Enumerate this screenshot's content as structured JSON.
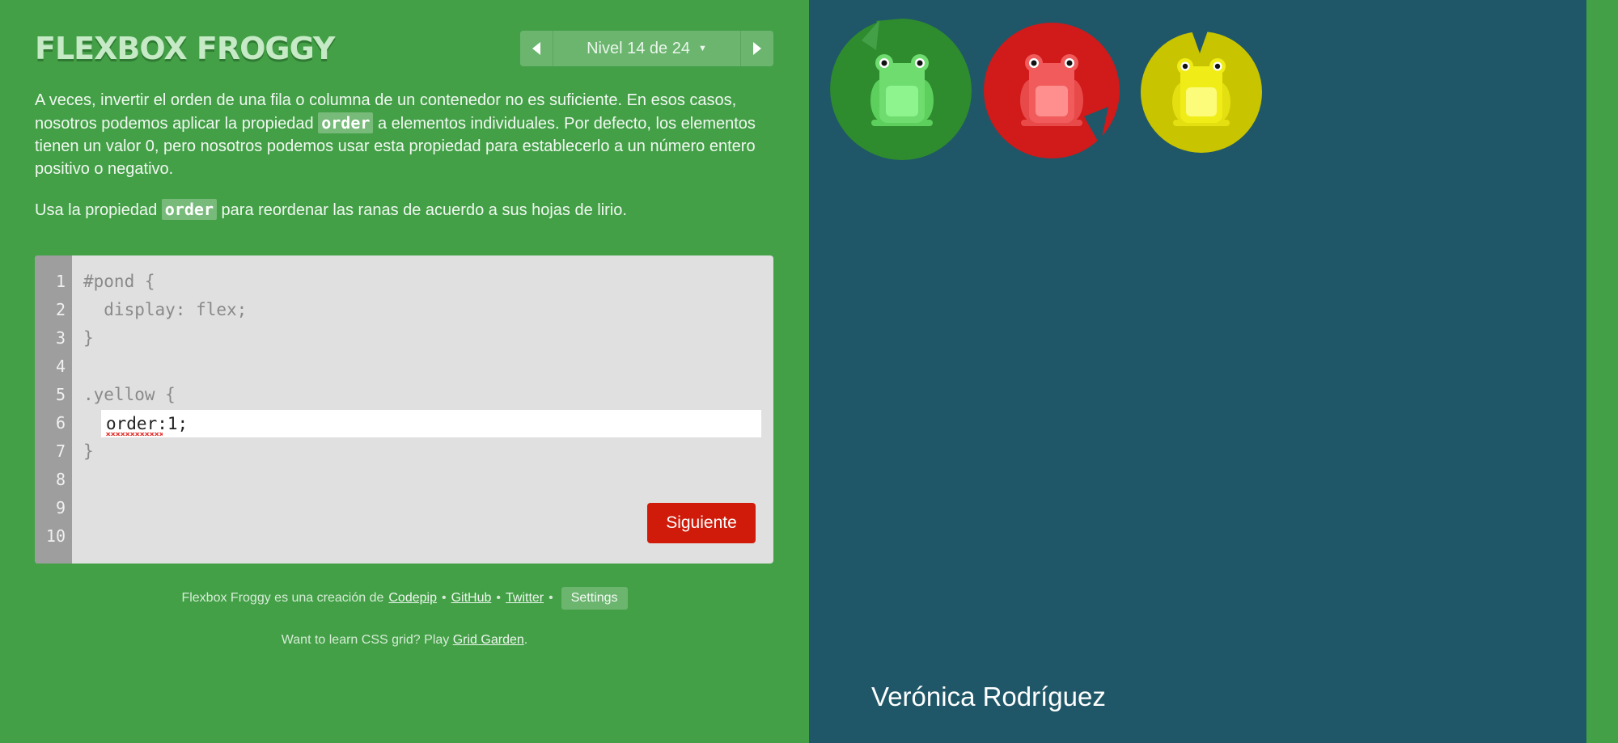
{
  "header": {
    "logo": "FLEXBOX FROGGY",
    "level_label": "Nivel 14 de 24"
  },
  "instructions": {
    "p1_a": "A veces, invertir el orden de una fila o columna de un contenedor no es suficiente. En esos casos, nosotros podemos aplicar la propiedad ",
    "p1_code": "order",
    "p1_b": " a elementos individuales. Por defecto, los elementos tienen un valor 0, pero nosotros podemos usar esta propiedad para establecerlo a un número entero positivo o negativo.",
    "p2_a": "Usa la propiedad ",
    "p2_code": "order",
    "p2_b": " para reordenar las ranas de acuerdo a sus hojas de lirio."
  },
  "editor": {
    "line_numbers": [
      "1",
      "2",
      "3",
      "4",
      "5",
      "6",
      "7",
      "8",
      "9",
      "10"
    ],
    "lines": [
      "#pond {",
      "  display: flex;",
      "}",
      "",
      ".yellow {",
      "",
      "}",
      "",
      "",
      ""
    ],
    "input_value": "order:1;",
    "next_button": "Siguiente"
  },
  "footer": {
    "credits_prefix": "Flexbox Froggy es una creación de",
    "link_codepip": "Codepip",
    "sep": "•",
    "link_github": "GitHub",
    "link_twitter": "Twitter",
    "settings": "Settings",
    "grid_prefix": "Want to learn CSS grid? Play",
    "grid_link": "Grid Garden",
    "grid_suffix": "."
  },
  "pond": {
    "frogs": [
      {
        "color": "green",
        "pad": "#2e8b2e",
        "body": "#6fdc6f",
        "belly": "#8ef58e"
      },
      {
        "color": "red",
        "pad": "#d11a1a",
        "body": "#f15b5b",
        "belly": "#ff8f8f"
      },
      {
        "color": "yellow",
        "pad": "#c9c400",
        "body": "#f0ec18",
        "belly": "#fdfb7a"
      }
    ]
  },
  "author": "Verónica Rodríguez",
  "colors": {
    "sidebar_bg": "#43a047",
    "pond_bg": "#1f5768",
    "next_button": "#d01b0a"
  }
}
